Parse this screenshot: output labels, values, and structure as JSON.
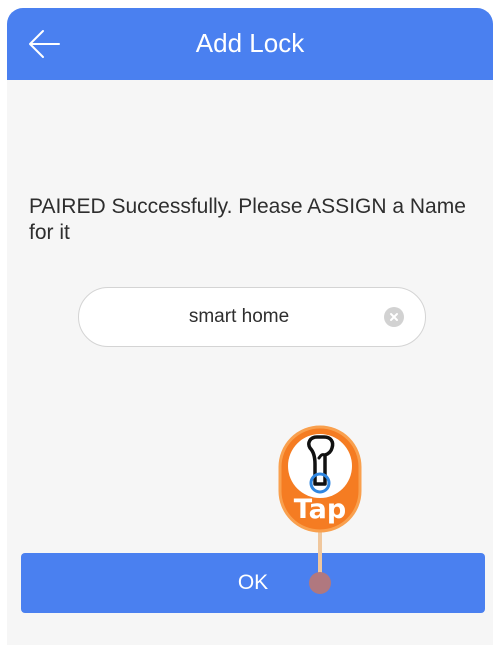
{
  "header": {
    "title": "Add Lock",
    "back_icon": "arrow-left-icon"
  },
  "main": {
    "message": "PAIRED Successfully. Please ASSIGN a Name for it",
    "name_input": {
      "value": "smart home",
      "clear_icon": "clear-icon"
    },
    "ok_label": "OK"
  },
  "tap_hint": {
    "label": "Tap",
    "icon": "pointing-hand-icon"
  },
  "colors": {
    "primary": "#4a80f0",
    "background": "#f6f6f6",
    "hint": "#f57c22",
    "tap_marker": "#b0787f"
  }
}
